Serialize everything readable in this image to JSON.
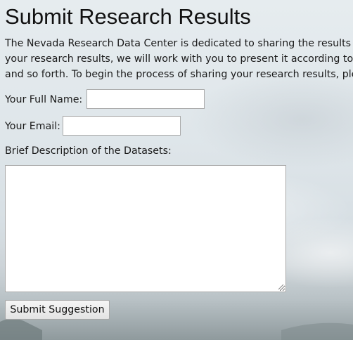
{
  "page": {
    "title": "Submit Research Results",
    "intro_lines": [
      "The Nevada Research Data Center is dedicated to sharing the results o",
      "your research results, we will work with you to present it according to y",
      "and so forth. To begin the process of sharing your research results, ple"
    ]
  },
  "form": {
    "name_label": "Your Full Name:",
    "name_value": "",
    "email_label": "Your Email:",
    "email_value": "",
    "description_label": "Brief Description of the Datasets:",
    "description_value": "",
    "submit_label": "Submit Suggestion"
  },
  "icons": {
    "resize_grip": "resize-grip-icon"
  },
  "colors": {
    "field_border": "#a9a9a9",
    "button_border": "#a6a6a6"
  }
}
